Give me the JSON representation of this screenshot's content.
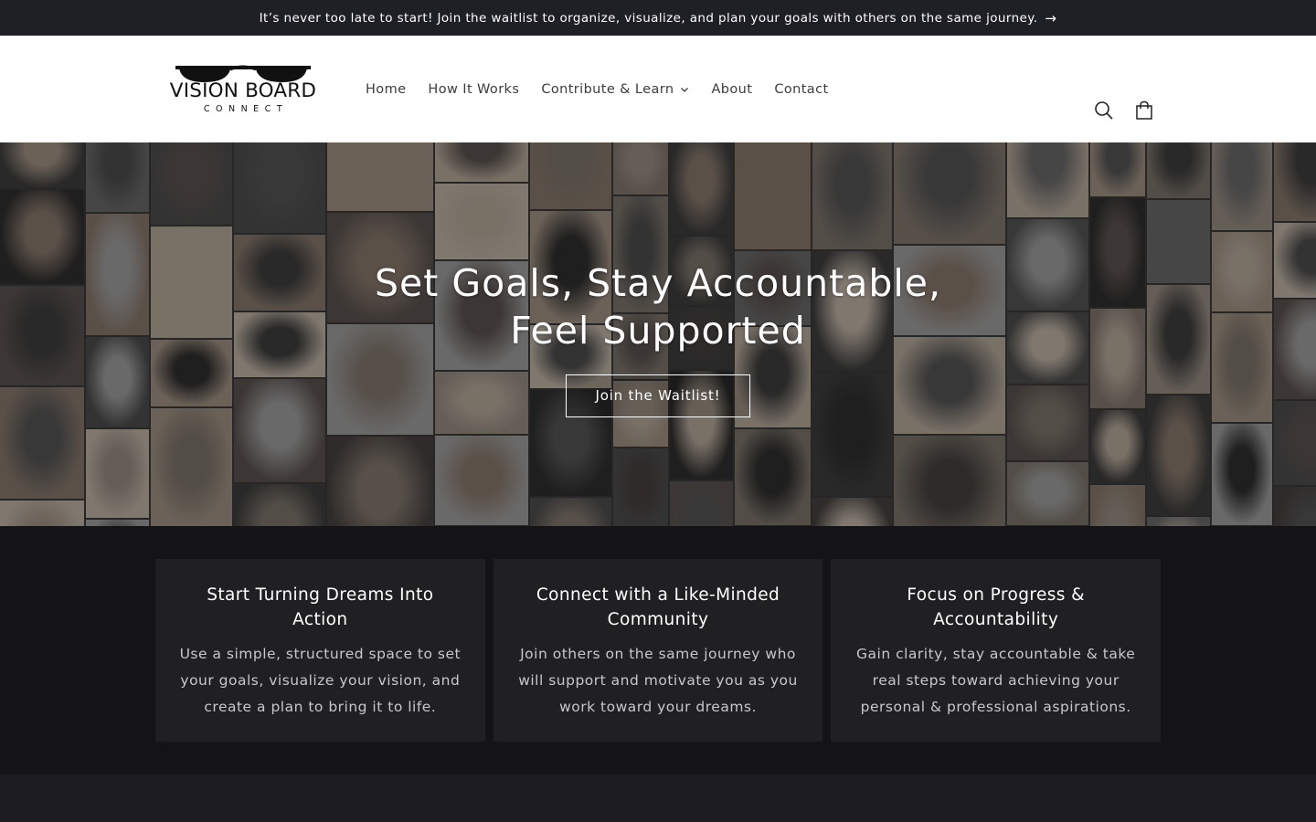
{
  "announcement": {
    "text": "It’s never too late to start! Join the waitlist to organize, visualize, and plan your goals with others on the same journey.",
    "arrow_icon": "arrow-right-icon"
  },
  "logo": {
    "title": "VISION BOARD",
    "subtitle": "CONNECT"
  },
  "nav": {
    "items": [
      {
        "label": "Home"
      },
      {
        "label": "How It Works"
      },
      {
        "label": "Contribute & Learn"
      },
      {
        "label": "About"
      },
      {
        "label": "Contact"
      }
    ]
  },
  "header_icons": [
    "search-icon",
    "cart-icon"
  ],
  "hero": {
    "title": "Set Goals, Stay Accountable, Feel Supported",
    "button_label": "Join the Waitlist!"
  },
  "features": [
    {
      "title": "Start Turning Dreams Into Action",
      "text": "Use a simple, structured space to set your goals, visualize your vision, and create a plan to bring it to life."
    },
    {
      "title": "Connect with a Like-Minded Community",
      "text": "Join others on the same journey who will support and motivate you as you work toward your dreams."
    },
    {
      "title": "Focus on Progress & Accountability",
      "text": "Gain clarity, stay accountable & take real steps toward achieving your personal & professional aspirations."
    }
  ],
  "colors": {
    "announcement_bg": "#1f1f26",
    "features_bg": "#141416",
    "card_bg": "#202023"
  }
}
